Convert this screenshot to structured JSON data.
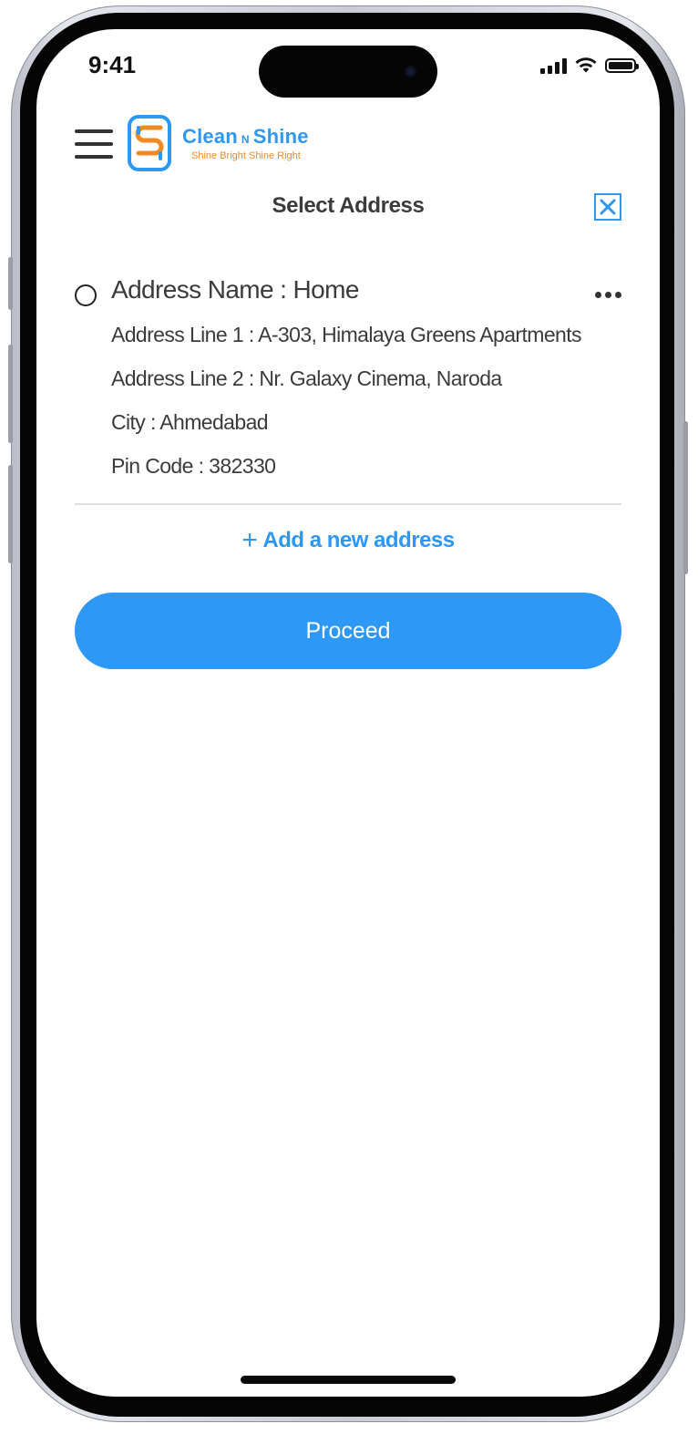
{
  "status_bar": {
    "time": "9:41"
  },
  "header": {
    "logo_name_part1": "Clean",
    "logo_name_part2": "N",
    "logo_name_part3": "Shine",
    "logo_tagline": "Shine Bright Shine Right"
  },
  "page": {
    "title": "Select Address"
  },
  "address": {
    "name": "Address Name : Home",
    "line1": "Address Line 1 : A-303, Himalaya Greens Apartments",
    "line2": "Address Line 2 : Nr. Galaxy Cinema, Naroda",
    "city": "City : Ahmedabad",
    "pincode": "Pin Code : 382330"
  },
  "actions": {
    "add_address_plus": "+",
    "add_address_label": "Add a new address",
    "proceed_label": "Proceed"
  },
  "icons": {
    "menu": "menu-icon",
    "close": "close-icon",
    "more": "more-icon",
    "signal": "signal-icon",
    "wifi": "wifi-icon",
    "battery": "battery-icon"
  },
  "colors": {
    "accent": "#2e98f7",
    "logo_orange": "#f08a24",
    "text": "#3b3b3b"
  }
}
